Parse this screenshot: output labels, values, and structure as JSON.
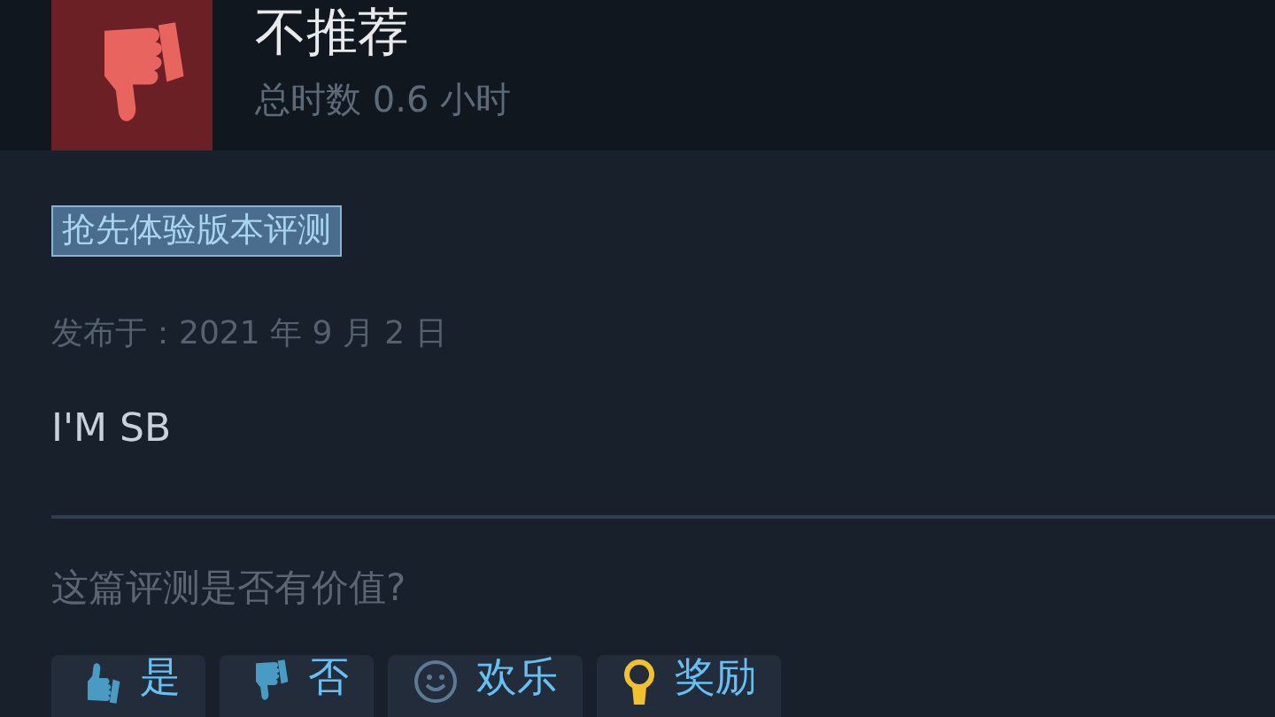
{
  "review": {
    "verdict": "不推荐",
    "recommended": false,
    "playtime": "总时数 0.6 小时",
    "badge": "抢先体验版本评测",
    "posted": "发布于：2021 年 9 月 2 日",
    "text": "I'M SB"
  },
  "feedback": {
    "question": "这篇评测是否有价值?",
    "buttons": [
      {
        "kind": "yes",
        "label": "是"
      },
      {
        "kind": "no",
        "label": "否"
      },
      {
        "kind": "funny",
        "label": "欢乐"
      },
      {
        "kind": "award",
        "label": "奖励"
      }
    ]
  }
}
